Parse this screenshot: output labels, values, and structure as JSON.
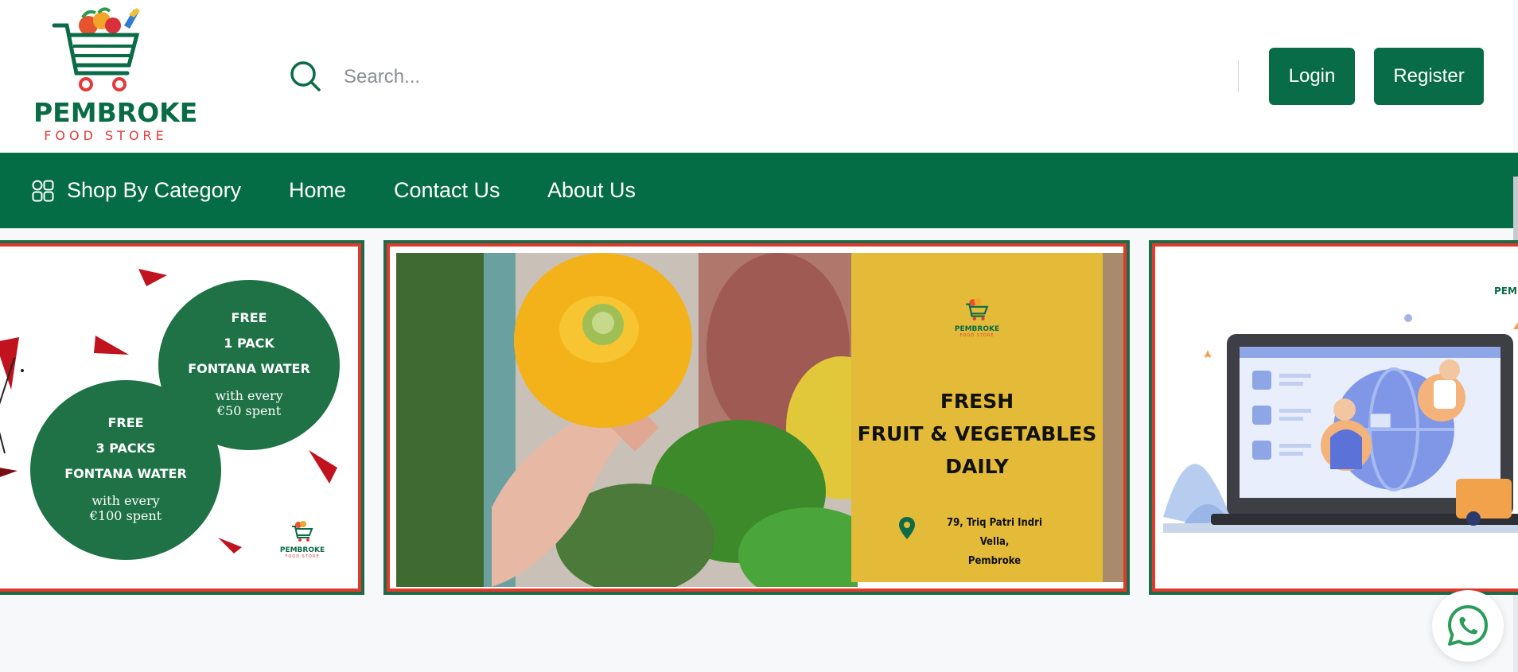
{
  "brand": {
    "name": "PEMBROKE",
    "tagline": "FOOD STORE",
    "accent": "#076c47",
    "secondary": "#e23a3a"
  },
  "search": {
    "placeholder": "Search...",
    "value": "",
    "icon": "search-icon"
  },
  "auth": {
    "login_label": "Login",
    "register_label": "Register"
  },
  "nav": {
    "category_label": "Shop By Category",
    "category_icon": "grid-icon",
    "items": [
      "Home",
      "Contact Us",
      "About Us"
    ]
  },
  "banners": {
    "water_offer": {
      "offer_a": {
        "line1": "FREE",
        "line2": "1 PACK",
        "line3": "FONTANA WATER",
        "cond1": "with every",
        "cond2": "€50 spent"
      },
      "offer_b": {
        "line1": "FREE",
        "line2": "3 PACKS",
        "line3": "FONTANA WATER",
        "cond1": "with every",
        "cond2": "€100 spent"
      },
      "logo_name": "PEMBROKE",
      "logo_tagline": "FOOD STORE"
    },
    "fresh": {
      "line1": "FRESH",
      "line2": "FRUIT & VEGETABLES",
      "line3": "DAILY",
      "address1": "79, Triq Patri Indri Vella,",
      "address2": "Pembroke",
      "logo_name": "PEMBROKE",
      "logo_tagline": "FOOD STORE"
    },
    "online": {
      "logo_name": "PEMBROKE"
    }
  },
  "whatsapp": {
    "icon": "whatsapp-icon"
  }
}
